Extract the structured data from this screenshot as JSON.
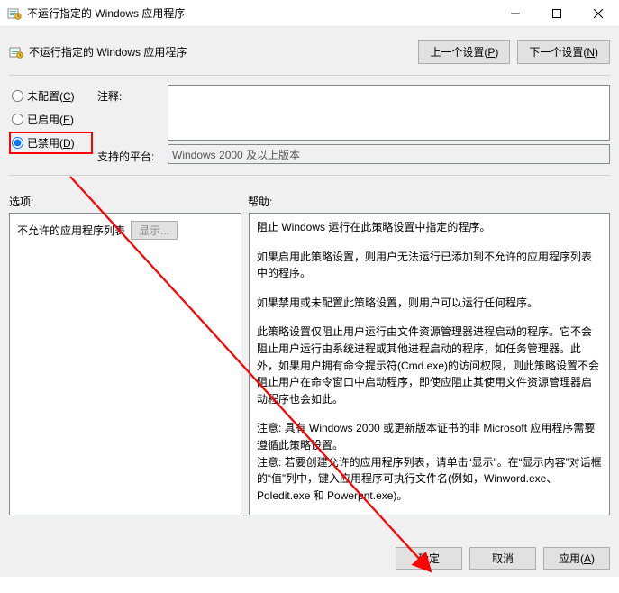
{
  "window": {
    "title": "不运行指定的 Windows 应用程序"
  },
  "header": {
    "title": "不运行指定的 Windows 应用程序",
    "prev_setting": "上一个设置(P)",
    "next_setting": "下一个设置(N)"
  },
  "radios": {
    "not_configured": "未配置(C)",
    "enabled": "已启用(E)",
    "disabled": "已禁用(D)",
    "selected": "disabled"
  },
  "labels": {
    "comment": "注释:",
    "platform": "支持的平台:",
    "options": "选项:",
    "help": "帮助:"
  },
  "fields": {
    "comment_value": "",
    "platform_value": "Windows 2000 及以上版本"
  },
  "options_panel": {
    "list_label": "不允许的应用程序列表",
    "show_button": "显示..."
  },
  "help": {
    "p1": "阻止 Windows 运行在此策略设置中指定的程序。",
    "p2": "如果启用此策略设置，则用户无法运行已添加到不允许的应用程序列表中的程序。",
    "p3": "如果禁用或未配置此策略设置，则用户可以运行任何程序。",
    "p4": "此策略设置仅阻止用户运行由文件资源管理器进程启动的程序。它不会阻止用户运行由系统进程或其他进程启动的程序，如任务管理器。此外，如果用户拥有命令提示符(Cmd.exe)的访问权限，则此策略设置不会阻止用户在命令窗口中启动程序，即使应阻止其使用文件资源管理器启动程序也会如此。",
    "p5": "注意: 具有 Windows 2000 或更新版本证书的非 Microsoft 应用程序需要遵循此策略设置。",
    "p6": "注意: 若要创建允许的应用程序列表，请单击“显示”。在“显示内容”对话框的“值”列中，键入应用程序可执行文件名(例如，Winword.exe、Poledit.exe 和 Powerpnt.exe)。"
  },
  "footer": {
    "ok": "确定",
    "cancel": "取消",
    "apply": "应用(A)"
  }
}
